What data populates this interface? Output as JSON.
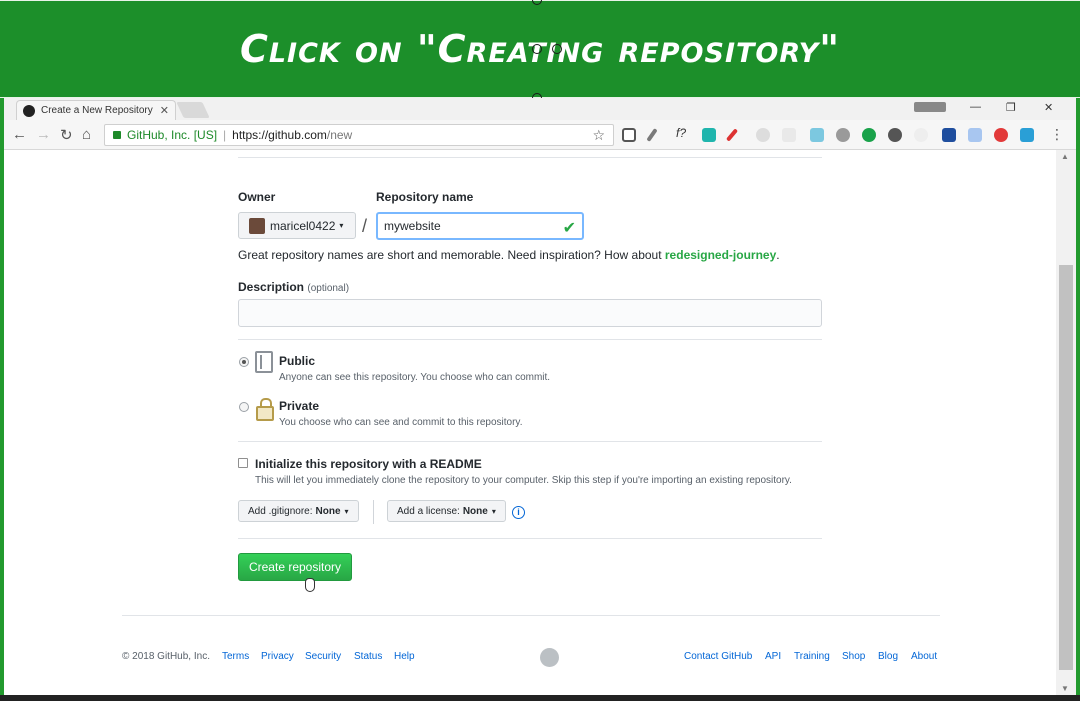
{
  "banner": {
    "text": "Click on \"Creating repository\""
  },
  "browser": {
    "tab_title": "Create a New Repository",
    "tab_close": "✕",
    "win_minimize": "—",
    "win_restore": "❐",
    "win_close": "✕",
    "nav_back": "←",
    "nav_forward": "→",
    "nav_reload": "↻",
    "nav_home": "⌂",
    "secure_label": "GitHub, Inc. [US]",
    "url_host": "https://github.com",
    "url_path": "/new",
    "bookmark_star": "☆",
    "menu": "⋮",
    "ext_fx": "f?"
  },
  "form": {
    "owner_label": "Owner",
    "owner_value": "maricel0422",
    "owner_caret": "▾",
    "slash": "/",
    "repo_label": "Repository name",
    "repo_value": "mywebsite",
    "repo_valid_mark": "✔",
    "hint_text": "Great repository names are short and memorable. Need inspiration? How about ",
    "hint_suggestion": "redesigned-journey",
    "hint_end": ".",
    "description_label": "Description",
    "description_optional": "(optional)",
    "description_value": "",
    "public_title": "Public",
    "public_sub": "Anyone can see this repository. You choose who can commit.",
    "private_title": "Private",
    "private_sub": "You choose who can see and commit to this repository.",
    "visibility_selected": "Public",
    "readme_title": "Initialize this repository with a README",
    "readme_sub": "This will let you immediately clone the repository to your computer. Skip this step if you're importing an existing repository.",
    "readme_checked": false,
    "gitignore_label": "Add .gitignore:",
    "gitignore_value": "None",
    "license_label": "Add a license:",
    "license_value": "None",
    "dropdown_caret": "▾",
    "info_glyph": "i",
    "create_button": "Create repository"
  },
  "footer": {
    "copyright": "© 2018 GitHub, Inc.",
    "left_links": [
      "Terms",
      "Privacy",
      "Security",
      "Status",
      "Help"
    ],
    "right_links": [
      "Contact GitHub",
      "API",
      "Training",
      "Shop",
      "Blog",
      "About"
    ]
  },
  "colors": {
    "banner_green": "#1c8f2a",
    "create_button_green": "#28a745",
    "link_blue": "#0366d6",
    "secure_green": "#1e8a2a"
  }
}
